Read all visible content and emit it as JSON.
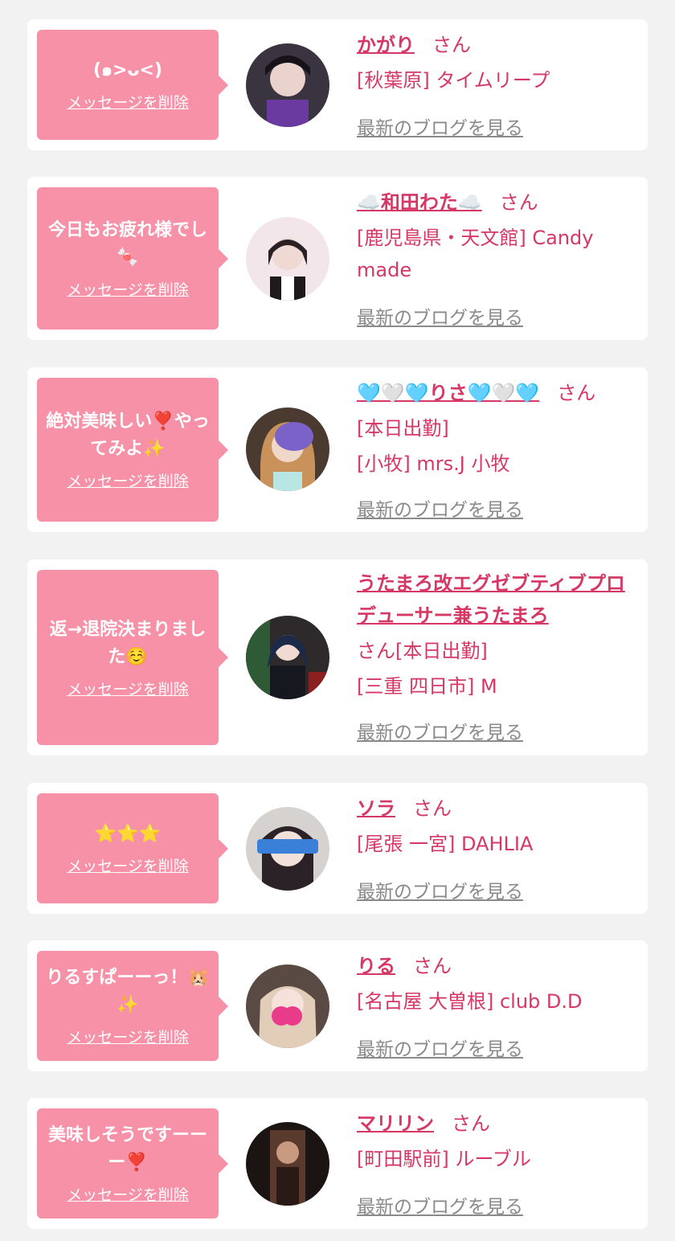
{
  "colors": {
    "bubble": "#f691a8",
    "accent": "#d63866",
    "blog_link": "#8a8a8a",
    "background": "#f2f2f2"
  },
  "delete_label": "メッセージを削除",
  "blog_label": "最新のブログを見る",
  "san_label": "さん",
  "cards": [
    {
      "message": "(๑>ᴗ<)",
      "name": "かがり",
      "lines": [
        "[秋葉原] タイムリープ"
      ]
    },
    {
      "message": "今日もお疲れ様でし🍬",
      "name": "☁️和田わた☁️",
      "lines": [
        "[鹿児島県・天文館] Candy made"
      ]
    },
    {
      "message": "絶対美味しい❣️やってみよ✨",
      "name": "🩵🤍🩵りさ🩵🤍🩵",
      "lines": [
        "[本日出勤]",
        "[小牧] mrs.J 小牧"
      ]
    },
    {
      "message": "返→退院決まりました☺️",
      "name": "うたまろ改エグゼブティブプロデューサー兼うたまろ",
      "lines": [
        "さん[本日出勤]",
        "[三重 四日市] M"
      ]
    },
    {
      "message": "⭐⭐⭐",
      "name": "ソラ",
      "lines": [
        "[尾張 一宮] DAHLIA"
      ]
    },
    {
      "message": "りるすぱーーっ！🐹✨",
      "name": "りる",
      "lines": [
        "[名古屋 大曽根] club D.D"
      ]
    },
    {
      "message": "美味しそうですーーー❣️",
      "name": "マリリン",
      "lines": [
        "[町田駅前] ルーブル"
      ]
    }
  ]
}
